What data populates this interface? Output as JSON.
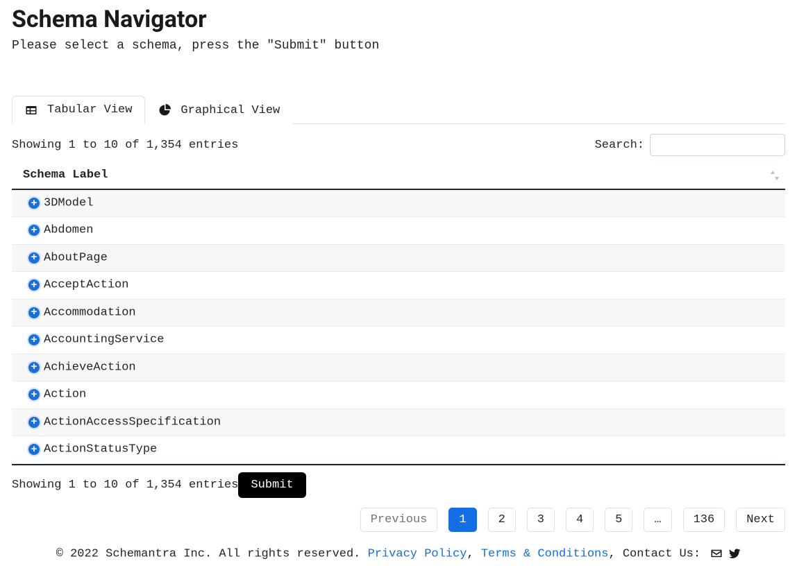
{
  "page": {
    "title": "Schema Navigator",
    "subtitle": "Please select a schema, press the \"Submit\" button"
  },
  "tabs": {
    "tabular": "Tabular View",
    "graphical": "Graphical View"
  },
  "search": {
    "label": "Search:",
    "value": ""
  },
  "table": {
    "info_top": "Showing 1 to 10 of 1,354 entries",
    "info_bottom": "Showing 1 to 10 of 1,354 entries",
    "header": "Schema Label",
    "rows": [
      "3DModel",
      "Abdomen",
      "AboutPage",
      "AcceptAction",
      "Accommodation",
      "AccountingService",
      "AchieveAction",
      "Action",
      "ActionAccessSpecification",
      "ActionStatusType"
    ]
  },
  "submit": "Submit",
  "pagination": {
    "previous": "Previous",
    "pages": [
      "1",
      "2",
      "3",
      "4",
      "5",
      "…",
      "136"
    ],
    "next": "Next",
    "active_index": 0
  },
  "footer": {
    "copyright": "© 2022 Schemantra Inc. All rights reserved. ",
    "privacy": "Privacy Policy",
    "sep1": ", ",
    "terms": "Terms & Conditions",
    "sep2": ", Contact Us: "
  }
}
